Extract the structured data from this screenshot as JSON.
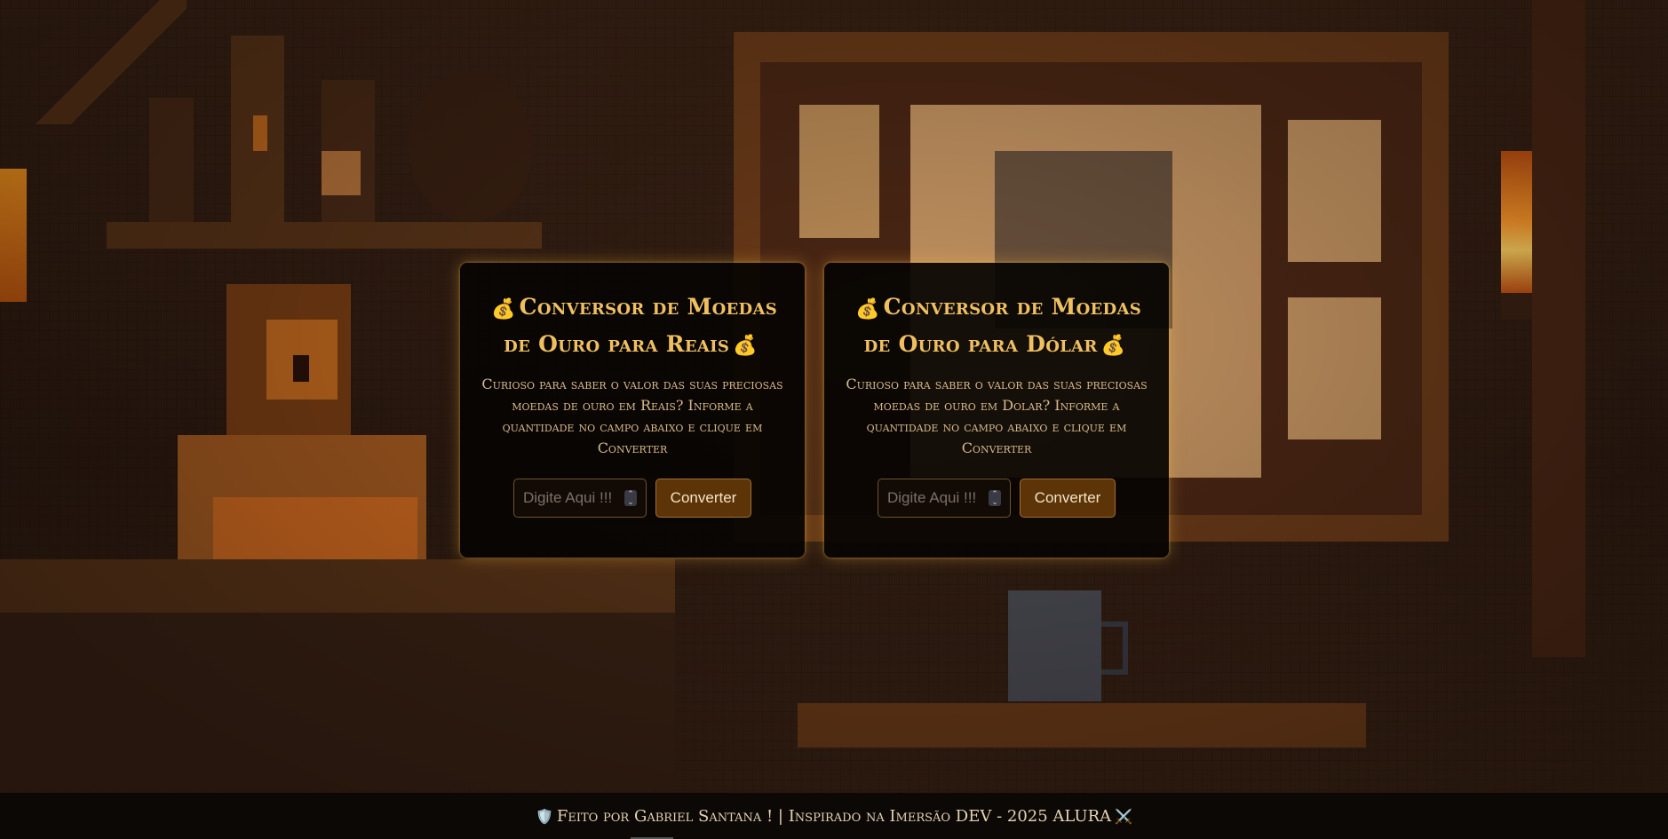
{
  "cards": [
    {
      "title_prefix_icon": "💰",
      "title": "Conversor de Moedas de Ouro para Reais",
      "title_suffix_icon": "💰",
      "description": "Curioso para saber o valor das suas preciosas moedas de ouro em Reais? Informe a quantidade no campo abaixo e clique em Converter",
      "input_placeholder": "Digite Aqui !!!",
      "button_label": "Converter"
    },
    {
      "title_prefix_icon": "💰",
      "title": "Conversor de Moedas de Ouro para Dólar",
      "title_suffix_icon": "💰",
      "description": "Curioso para saber o valor das suas preciosas moedas de ouro em Dolar? Informe a quantidade no campo abaixo e clique em Converter",
      "input_placeholder": "Digite Aqui !!!",
      "button_label": "Converter"
    }
  ],
  "footer": {
    "left_icon": "🛡️",
    "text": "Feito por Gabriel Santana ! | Inspirado na Imersão DEV - 2025 ALURA",
    "right_icon": "⚔️"
  },
  "colors": {
    "title": "#f0c060",
    "description": "#d9b98a",
    "button_bg": "#5c3407",
    "footer_bg": "#0b0806"
  }
}
